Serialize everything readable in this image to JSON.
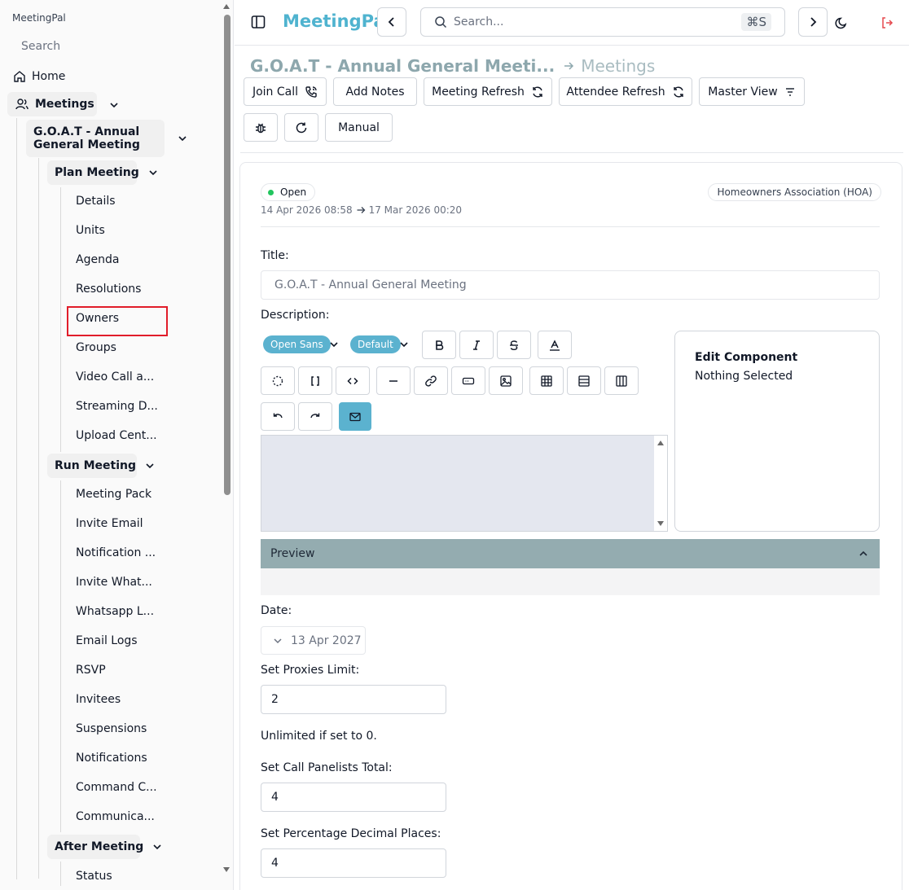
{
  "app": {
    "name": "MeetingPal"
  },
  "sidebar": {
    "search_placeholder": "Search",
    "home": "Home",
    "meetings": "Meetings",
    "meeting_title": "G.O.A.T - Annual General Meeting",
    "meeting_title_line1": "G.O.A.T - Annual",
    "meeting_title_line2": "General Meeting",
    "plan_meeting": {
      "label": "Plan Meeting",
      "items": [
        "Details",
        "Units",
        "Agenda",
        "Resolutions",
        "Owners",
        "Groups",
        "Video Call a...",
        "Streaming D...",
        "Upload Cent..."
      ]
    },
    "run_meeting": {
      "label": "Run Meeting",
      "items": [
        "Meeting Pack",
        "Invite Email",
        "Notification ...",
        "Invite What...",
        "Whatsapp L...",
        "Email Logs",
        "RSVP",
        "Invitees",
        "Suspensions",
        "Notifications",
        "Command C...",
        "Communica..."
      ]
    },
    "after_meeting": {
      "label": "After Meeting",
      "items": [
        "Status"
      ]
    },
    "highlighted_item": "Owners"
  },
  "topbar": {
    "brand": "MeetingPal",
    "search_placeholder": "Search...",
    "shortcut": "⌘S"
  },
  "breadcrumb": {
    "current": "G.O.A.T - Annual General Meeti...",
    "parent": "Meetings"
  },
  "actions": {
    "join_call": "Join Call",
    "add_notes": "Add Notes",
    "meeting_refresh": "Meeting Refresh",
    "attendee_refresh": "Attendee Refresh",
    "master_view": "Master View",
    "manual": "Manual"
  },
  "meeting": {
    "status": "Open",
    "start": "14 Apr 2026 08:58",
    "end": "17 Mar 2026 00:20",
    "organization": "Homeowners Association (HOA)"
  },
  "form": {
    "title_label": "Title:",
    "title_value": "G.O.A.T - Annual General Meeting",
    "description_label": "Description:",
    "font_family": "Open Sans",
    "font_size": "Default",
    "edit_component_title": "Edit Component",
    "edit_component_status": "Nothing Selected",
    "preview_label": "Preview",
    "date_label": "Date:",
    "date_value": "13 Apr 2027",
    "proxies_label": "Set Proxies Limit:",
    "proxies_value": "2",
    "proxies_hint": "Unlimited if set to 0.",
    "panelists_label": "Set Call Panelists Total:",
    "panelists_value": "4",
    "decimals_label": "Set Percentage Decimal Places:",
    "decimals_value": "4"
  },
  "colors": {
    "brand": "#4fb3cf",
    "accent": "#5bb2cf",
    "status_open": "#22c55e",
    "logout": "#e5484d",
    "highlight": "#e11d2a"
  }
}
